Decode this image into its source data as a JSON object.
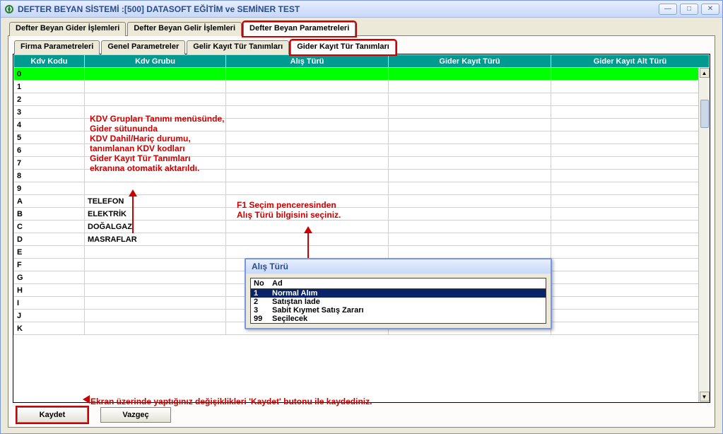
{
  "window": {
    "title": "DEFTER BEYAN SİSTEMİ  :[500]  DATASOFT EĞİTİM ve SEMİNER TEST"
  },
  "tabs_top": {
    "items": [
      "Defter Beyan Gider İşlemleri",
      "Defter Beyan Gelir İşlemleri",
      "Defter Beyan Parametreleri"
    ],
    "active": 2
  },
  "tabs_inner": {
    "items": [
      "Firma Parametreleri",
      "Genel Parametreler",
      "Gelir Kayıt Tür Tanımları",
      "Gider Kayıt Tür Tanımları"
    ],
    "active": 3
  },
  "grid": {
    "headers": [
      "Kdv Kodu",
      "Kdv Grubu",
      "Alış Türü",
      "Gider Kayıt Türü",
      "Gider Kayıt Alt Türü"
    ],
    "rows": [
      {
        "k": "0",
        "g": "",
        "sel": true
      },
      {
        "k": "1",
        "g": ""
      },
      {
        "k": "2",
        "g": ""
      },
      {
        "k": "3",
        "g": ""
      },
      {
        "k": "4",
        "g": ""
      },
      {
        "k": "5",
        "g": ""
      },
      {
        "k": "6",
        "g": ""
      },
      {
        "k": "7",
        "g": ""
      },
      {
        "k": "8",
        "g": ""
      },
      {
        "k": "9",
        "g": ""
      },
      {
        "k": "A",
        "g": "TELEFON"
      },
      {
        "k": "B",
        "g": "ELEKTRİK"
      },
      {
        "k": "C",
        "g": "DOĞALGAZ"
      },
      {
        "k": "D",
        "g": "MASRAFLAR"
      },
      {
        "k": "E",
        "g": ""
      },
      {
        "k": "F",
        "g": ""
      },
      {
        "k": "G",
        "g": ""
      },
      {
        "k": "H",
        "g": ""
      },
      {
        "k": "I",
        "g": ""
      },
      {
        "k": "J",
        "g": ""
      },
      {
        "k": "K",
        "g": ""
      }
    ]
  },
  "popup": {
    "title": "Alış Türü",
    "head_no": "No",
    "head_ad": "Ad",
    "items": [
      {
        "no": "1",
        "ad": "Normal Alım",
        "sel": true
      },
      {
        "no": "2",
        "ad": "Satıştan İade"
      },
      {
        "no": "3",
        "ad": "Sabit Kıymet Satış Zararı"
      },
      {
        "no": "99",
        "ad": "Seçilecek"
      }
    ]
  },
  "buttons": {
    "save": "Kaydet",
    "cancel": "Vazgeç"
  },
  "annotations": {
    "a1": "KDV Grupları Tanımı menüsünde,\nGider sütununda\nKDV Dahil/Hariç durumu,\ntanımlanan KDV kodları\nGider Kayıt Tür Tanımları\nekranına otomatik aktarıldı.",
    "a2": "F1 Seçim penceresinden\nAlış Türü bilgisini seçiniz.",
    "a3": "Ekran üzerinde yaptığınız değişiklikleri 'Kaydet' butonu ile kaydediniz."
  }
}
